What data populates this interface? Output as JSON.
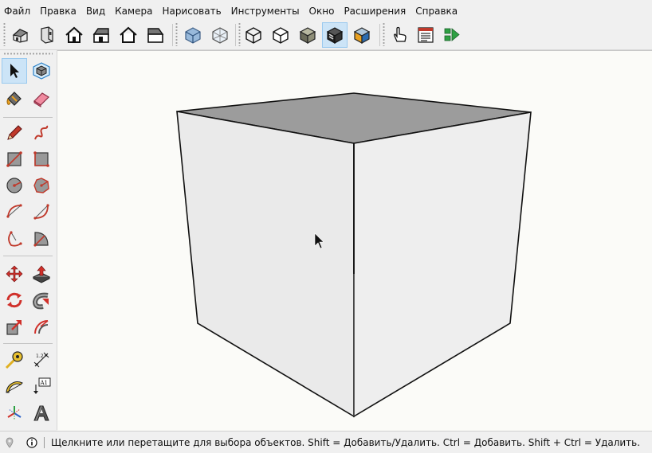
{
  "menu": [
    "Файл",
    "Правка",
    "Вид",
    "Камера",
    "Нарисовать",
    "Инструменты",
    "Окно",
    "Расширения",
    "Справка"
  ],
  "toolbar": {
    "groups": [
      [
        "iso-view-icon",
        "top-view-icon",
        "front-view-icon",
        "right-view-icon",
        "back-view-icon",
        "left-view-icon"
      ],
      [
        "xray-style-icon",
        "wireframe-style-icon",
        "hidden-line-style-icon",
        "shaded-style-icon",
        "shaded-textures-style-icon",
        "monochrome-style-icon"
      ],
      [
        "interact-icon",
        "generate-report-icon",
        "animation-play-icon"
      ]
    ],
    "active": "monochrome-style-icon"
  },
  "palette": {
    "active": "select-tool",
    "rows": [
      [
        "select-tool",
        "make-component-tool"
      ],
      [
        "paint-bucket-tool",
        "eraser-tool"
      ],
      [
        "line-tool",
        "freehand-tool"
      ],
      [
        "rectangle-tool",
        "rotated-rectangle-tool"
      ],
      [
        "circle-tool",
        "polygon-tool"
      ],
      [
        "arc-tool",
        "two-point-arc-tool"
      ],
      [
        "three-point-arc-tool",
        "pie-tool"
      ],
      [
        "move-tool",
        "push-pull-tool"
      ],
      [
        "rotate-tool",
        "follow-me-tool"
      ],
      [
        "scale-tool",
        "offset-tool"
      ],
      [
        "tape-measure-tool",
        "dimension-tool"
      ],
      [
        "protractor-tool",
        "text-tool"
      ],
      [
        "axes-tool",
        "3d-text-tool"
      ]
    ],
    "text_tool_label": "A1"
  },
  "viewport": {
    "background": "#fbfbf8",
    "model": "cube"
  },
  "status": {
    "message": "Щелкните или перетащите для выбора объектов. Shift = Добавить/Удалить. Ctrl = Добавить. Shift + Ctrl = Удалить."
  },
  "colors": {
    "cube_top": "#9c9c9c",
    "cube_left": "#eaeaea",
    "cube_right": "#eeeeee",
    "active_button": "#cce4f7"
  }
}
